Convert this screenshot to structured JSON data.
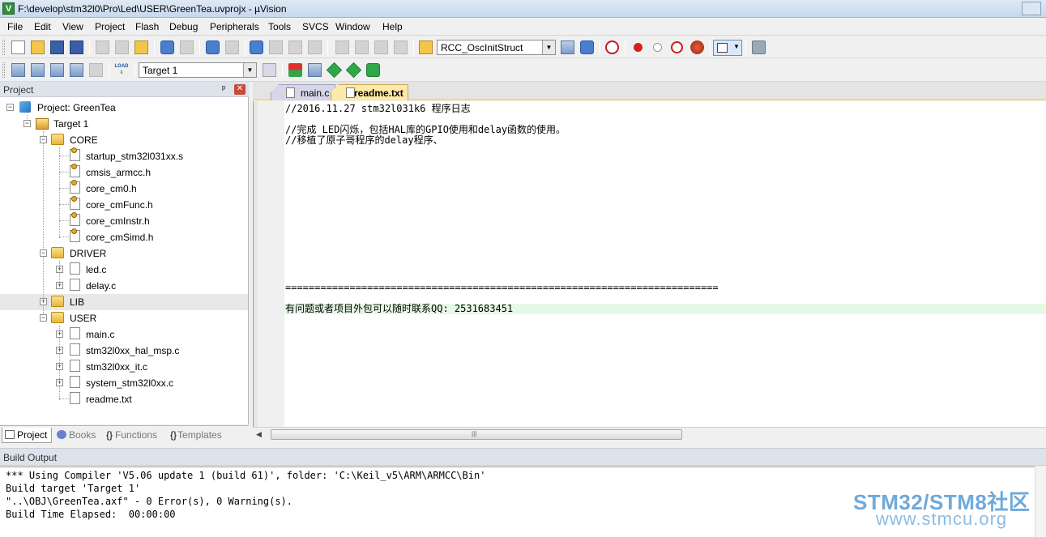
{
  "window": {
    "title": "F:\\develop\\stm32l0\\Pro\\Led\\USER\\GreenTea.uvprojx - µVision",
    "app_icon_letter": "V"
  },
  "menu": [
    "File",
    "Edit",
    "View",
    "Project",
    "Flash",
    "Debug",
    "Peripherals",
    "Tools",
    "SVCS",
    "Window",
    "Help"
  ],
  "toolbar": {
    "find_combo_value": "RCC_OscInitStruct",
    "target_combo_value": "Target 1",
    "load_label": "LOAD"
  },
  "project_panel": {
    "header": "Project",
    "pin": "ᵖ",
    "close": "✕",
    "root": "Project: GreenTea",
    "target": "Target 1",
    "groups": [
      {
        "name": "CORE",
        "files": [
          "startup_stm32l031xx.s",
          "cmsis_armcc.h",
          "core_cm0.h",
          "core_cmFunc.h",
          "core_cmInstr.h",
          "core_cmSimd.h"
        ]
      },
      {
        "name": "DRIVER",
        "files": [
          "led.c",
          "delay.c"
        ]
      },
      {
        "name": "LIB",
        "files": []
      },
      {
        "name": "USER",
        "files": [
          "main.c",
          "stm32l0xx_hal_msp.c",
          "stm32l0xx_it.c",
          "system_stm32l0xx.c",
          "readme.txt"
        ]
      }
    ],
    "tabs": [
      "Project",
      "Books",
      "Functions",
      "Templates"
    ],
    "tab_prefixes": [
      "",
      "",
      "{}",
      "{}"
    ]
  },
  "editor": {
    "tabs": [
      {
        "label": "main.c",
        "active": false
      },
      {
        "label": "readme.txt",
        "active": true
      }
    ],
    "lines": [
      "//2016.11.27 stm32l031k6 程序日志",
      "",
      "//完成 LED闪烁，包括HAL库的GPIO使用和delay函数的使用。",
      "//移植了原子哥程序的delay程序、",
      "",
      "",
      "",
      "",
      "",
      "",
      "",
      "",
      "",
      "",
      "",
      "",
      "",
      "==========================================================================",
      "",
      "有问题或者项目外包可以随时联系QQ: 2531683451"
    ],
    "highlighted_line_index": 19
  },
  "build_output": {
    "header": "Build Output",
    "lines": [
      "*** Using Compiler 'V5.06 update 1 (build 61)', folder: 'C:\\Keil_v5\\ARM\\ARMCC\\Bin'",
      "Build target 'Target 1'",
      "\"..\\OBJ\\GreenTea.axf\" - 0 Error(s), 0 Warning(s).",
      "Build Time Elapsed:  00:00:00"
    ]
  },
  "watermark": {
    "line1": "STM32/STM8社区",
    "line2": "www.stmcu.org"
  },
  "colors": {
    "highlight_line": "#e6f8e6",
    "active_tab": "#fde9a8",
    "tab_underline": "#f6d67a"
  }
}
